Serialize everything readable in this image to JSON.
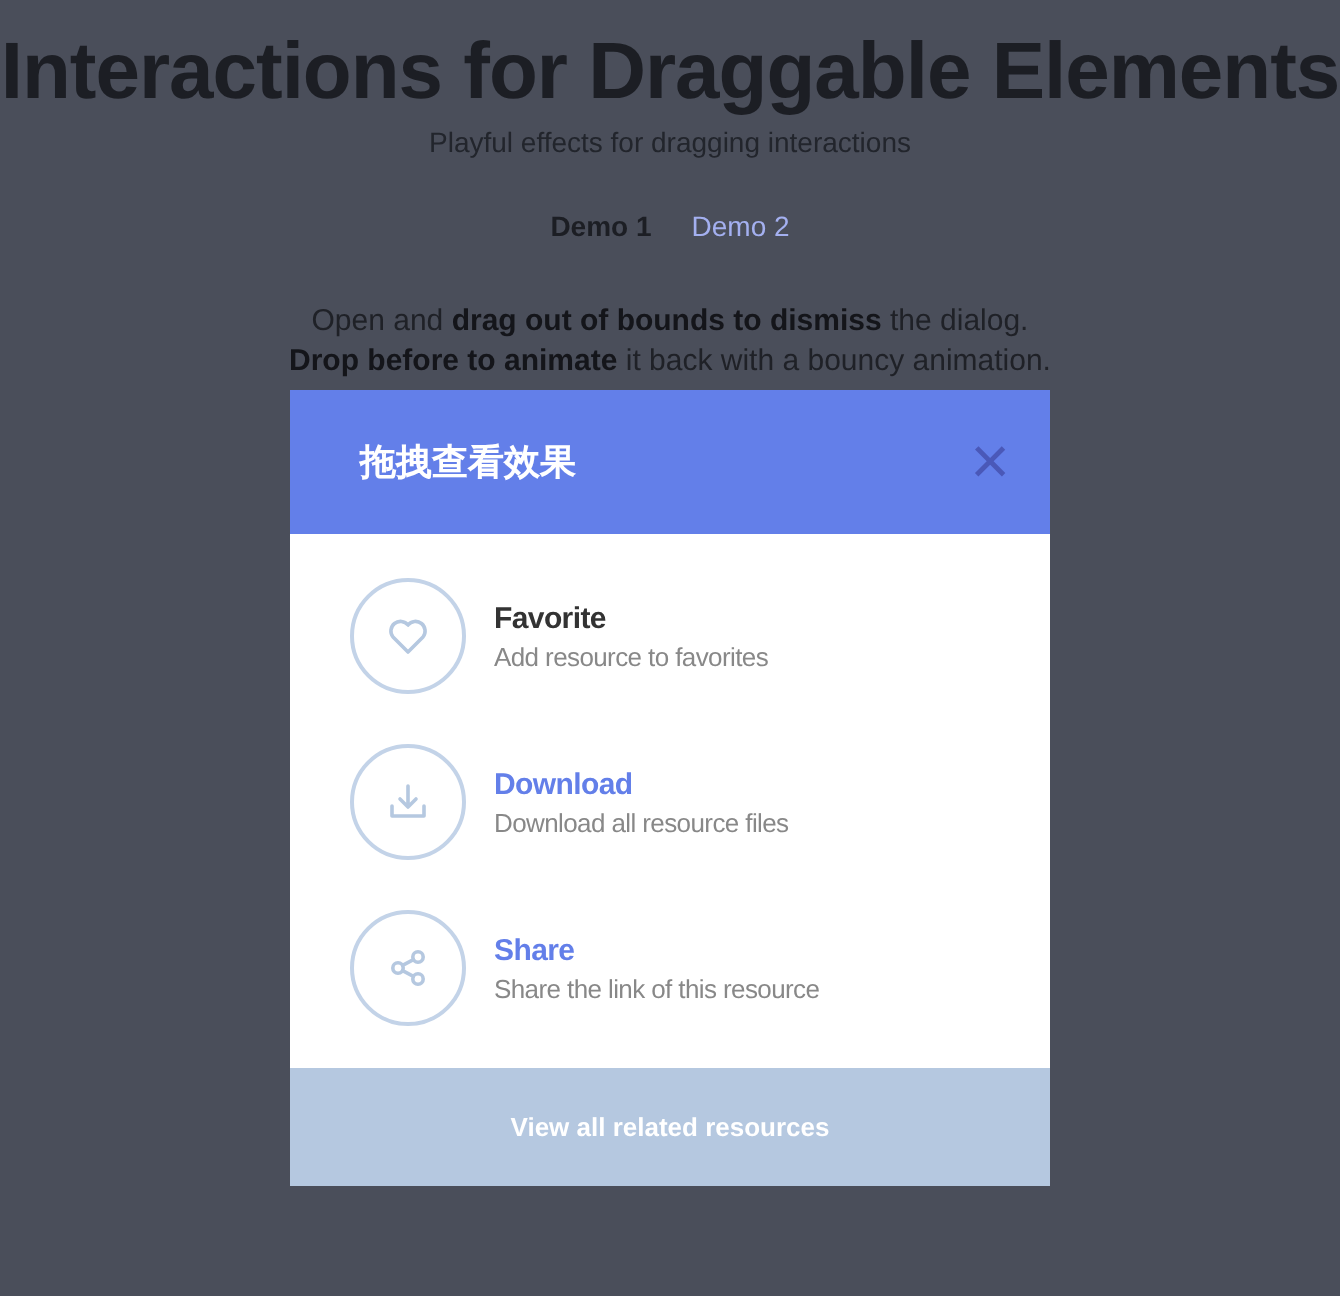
{
  "page": {
    "title": "Interactions for Draggable Elements",
    "subtitle": "Playful effects for dragging interactions",
    "nav": [
      {
        "label": "Demo 1",
        "selected": false
      },
      {
        "label": "Demo 2",
        "selected": true
      }
    ],
    "intro": [
      "Open and **drag out of bounds to dismiss** the dialog.",
      "**Drop before to animate** it back with a bouncy animation."
    ]
  },
  "dialog": {
    "title": "拖拽查看效果",
    "close": "×",
    "items": [
      {
        "kind": "heart",
        "title": "Favorite",
        "description": "Add resource to favorites",
        "highlighted": false
      },
      {
        "kind": "download",
        "title": "Download",
        "description": "Download all resource files",
        "highlighted": true
      },
      {
        "kind": "share",
        "title": "Share",
        "description": "Share the link of this resource",
        "highlighted": true
      }
    ],
    "footer": "View all related resources"
  }
}
